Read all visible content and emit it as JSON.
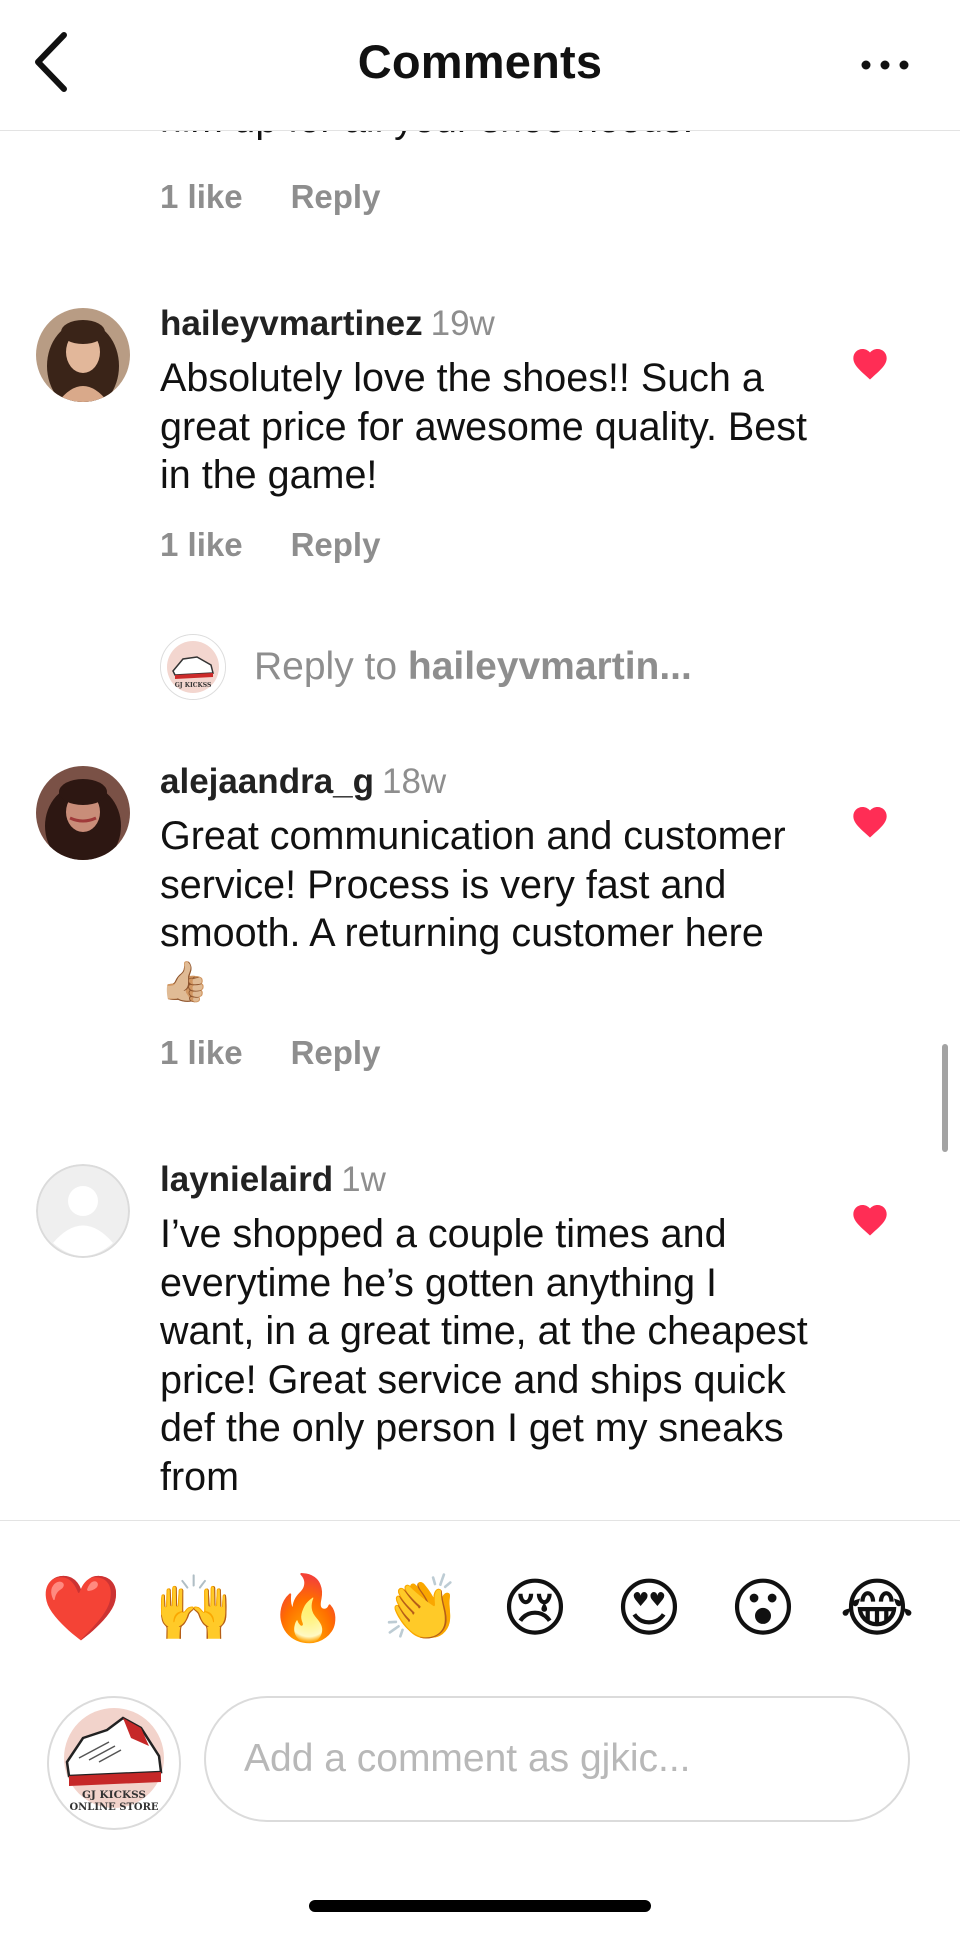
{
  "header": {
    "title": "Comments",
    "back_icon": "chevron-left-icon",
    "more_icon": "more-horizontal-icon"
  },
  "previous_comment": {
    "partial_text": "him up for all your shoe needs.",
    "likes": "1 like",
    "reply": "Reply"
  },
  "comments": [
    {
      "username": "haileyvmartinez",
      "time": "19w",
      "text": "Absolutely love the shoes!! Such a great price for awesome quality. Best in the game!",
      "likes": "1 like",
      "reply": "Reply",
      "liked": true
    },
    {
      "username": "alejaandra_g",
      "time": "18w",
      "text": "Great communication and customer service! Process is very fast and smooth. A returning customer here 👍🏼",
      "likes": "1 like",
      "reply": "Reply",
      "liked": true
    },
    {
      "username": "laynielaird",
      "time": "1w",
      "text": "I’ve shopped a couple times and everytime he’s gotten anything I want, in a great time, at the cheapest price! Great service and ships quick def the only person I get my sneaks from",
      "liked": true
    }
  ],
  "reply_prompt": {
    "prefix": "Reply to ",
    "username": "haileyvmartin..."
  },
  "emoji_bar": [
    "❤️",
    "🙌",
    "🔥",
    "👏",
    "😢",
    "😍",
    "😮",
    "😂"
  ],
  "composer": {
    "placeholder": "Add a comment as gjkic...",
    "avatar_lines": [
      "GJ KICKSS",
      "ONLINE STORE"
    ]
  },
  "colors": {
    "heart": "#ff2d55",
    "muted": "#8e8e8e",
    "divider": "#e3e3e3"
  }
}
